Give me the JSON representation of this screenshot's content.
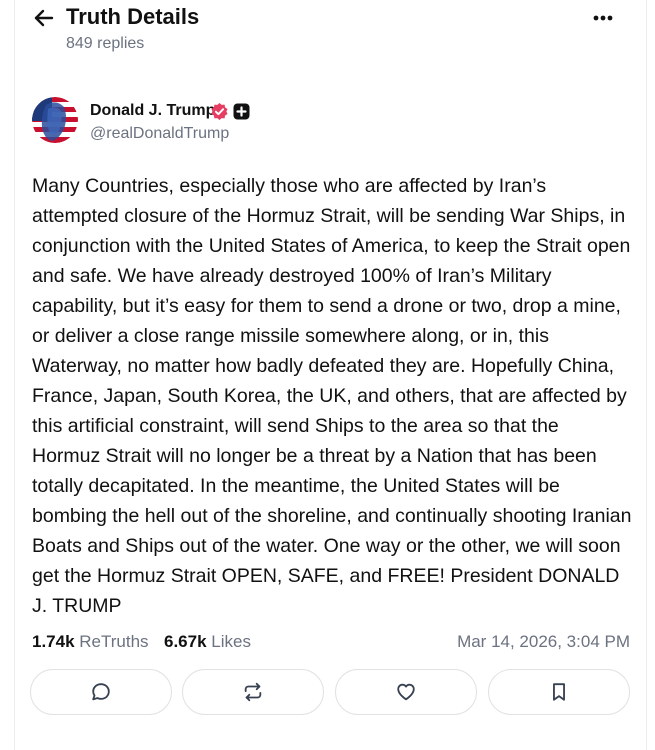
{
  "header": {
    "title": "Truth Details",
    "replies": "849 replies"
  },
  "post": {
    "author_name": "Donald J. Trump",
    "handle": "@realDonaldTrump",
    "body": "Many Countries, especially those who are affected by Iran’s attempted closure of the Hormuz Strait, will be sending War Ships, in conjunction with the United States of America, to keep the Strait open and safe. We have already destroyed 100% of Iran’s Military capability, but it’s easy for them to send a drone or two, drop a mine, or deliver a close range missile somewhere along, or in, this Waterway, no matter how badly defeated they are. Hopefully China, France, Japan, South Korea, the UK, and others, that are affected by this artificial constraint, will send Ships to the area so that the Hormuz Strait will no longer be a threat by a Nation that has been totally decapitated. In the meantime, the United States will be bombing the hell out of the shoreline, and continually shooting Iranian Boats and Ships out of the water. One way or the other, we will soon get the Hormuz Strait OPEN, SAFE, and FREE! President DONALD J. TRUMP"
  },
  "stats": {
    "retruths_count": "1.74k",
    "retruths_label": "ReTruths",
    "likes_count": "6.67k",
    "likes_label": "Likes",
    "timestamp": "Mar 14, 2026, 3:04 PM"
  },
  "icons": {
    "back": "arrow-left-icon",
    "more": "more-horizontal-icon",
    "verified": "verified-badge-icon",
    "plus": "plus-badge-icon",
    "reply": "reply-icon",
    "retruth": "retruth-icon",
    "like": "heart-icon",
    "bookmark": "bookmark-icon"
  },
  "colors": {
    "verified": "#e63e62",
    "muted_text": "#6b7280",
    "text": "#111111"
  }
}
